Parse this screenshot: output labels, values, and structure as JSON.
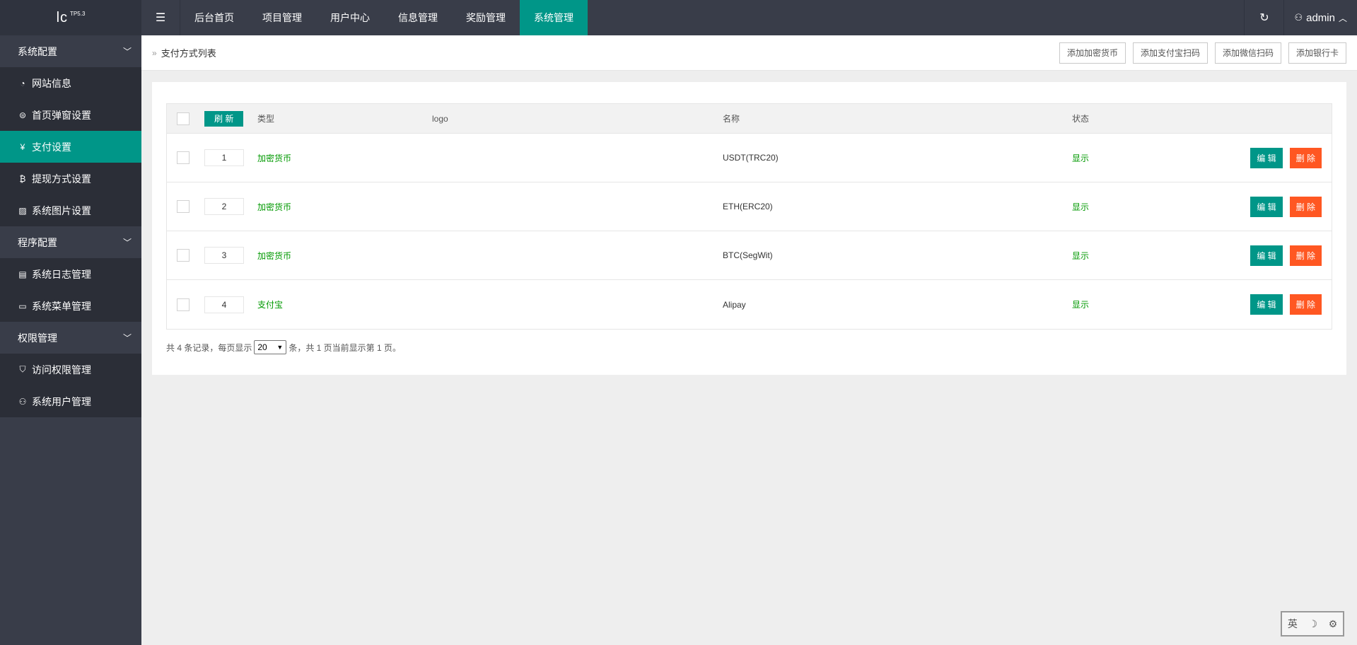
{
  "logo": {
    "main": "lc",
    "sup": "TP5.3"
  },
  "header": {
    "toggle_icon": "menu-fold-icon",
    "nav": [
      "后台首页",
      "项目管理",
      "用户中心",
      "信息管理",
      "奖励管理",
      "系统管理"
    ],
    "active_nav": "系统管理",
    "user": "admin"
  },
  "sidebar": {
    "groups": [
      {
        "label": "系统配置",
        "items": [
          {
            "label": "网站信息",
            "icon": "dashboard-icon"
          },
          {
            "label": "首页弹窗设置",
            "icon": "popup-icon"
          },
          {
            "label": "支付设置",
            "icon": "yen-icon",
            "active": true
          },
          {
            "label": "提现方式设置",
            "icon": "bitcoin-icon"
          },
          {
            "label": "系统图片设置",
            "icon": "image-icon"
          }
        ]
      },
      {
        "label": "程序配置",
        "items": [
          {
            "label": "系统日志管理",
            "icon": "log-icon"
          },
          {
            "label": "系统菜单管理",
            "icon": "menu-icon"
          }
        ]
      },
      {
        "label": "权限管理",
        "items": [
          {
            "label": "访问权限管理",
            "icon": "shield-icon"
          },
          {
            "label": "系统用户管理",
            "icon": "user-icon"
          }
        ]
      }
    ]
  },
  "topbar": {
    "breadcrumb": "支付方式列表",
    "buttons": [
      "添加加密货币",
      "添加支付宝扫码",
      "添加微信扫码",
      "添加银行卡"
    ]
  },
  "table": {
    "refresh_label": "刷 新",
    "headers": {
      "type": "类型",
      "logo": "logo",
      "name": "名称",
      "status": "状态"
    },
    "rows": [
      {
        "sort": "1",
        "type": "加密货币",
        "name": "USDT(TRC20)",
        "status": "显示"
      },
      {
        "sort": "2",
        "type": "加密货币",
        "name": "ETH(ERC20)",
        "status": "显示"
      },
      {
        "sort": "3",
        "type": "加密货币",
        "name": "BTC(SegWit)",
        "status": "显示"
      },
      {
        "sort": "4",
        "type": "支付宝",
        "name": "Alipay",
        "status": "显示"
      }
    ],
    "edit_label": "编 辑",
    "delete_label": "删 除"
  },
  "pager": {
    "prefix": "共 4 条记录，每页显示",
    "per_page": "20",
    "suffix": "条，共 1 页当前显示第 1 页。"
  },
  "ime": {
    "lang": "英",
    "moon": "☽",
    "tool": "⚙"
  }
}
